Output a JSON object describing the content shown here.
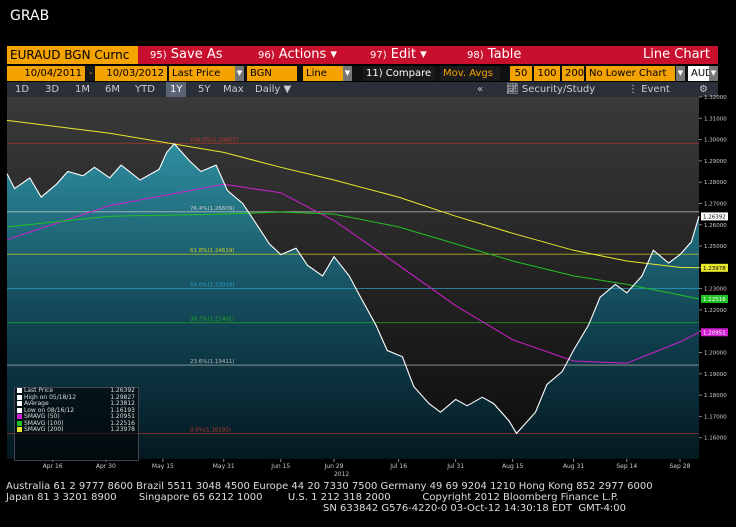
{
  "window_title": "GRAB",
  "toolbar": {
    "ticker": "EURAUD BGN Curnc",
    "actions": [
      {
        "num": "95)",
        "label": "Save As"
      },
      {
        "num": "96)",
        "label": "Actions"
      },
      {
        "num": "97)",
        "label": "Edit"
      },
      {
        "num": "98)",
        "label": "Table"
      }
    ],
    "chart_type": "Line Chart"
  },
  "params": {
    "start_date": "10/04/2011",
    "end_date": "10/03/2012",
    "field": "Last Price",
    "source": "BGN",
    "style": "Line",
    "compare": "11) Compare",
    "mov_avgs": "Mov. Avgs",
    "ma1": "50",
    "ma2": "100",
    "ma3": "200",
    "lower_chart": "No Lower Chart",
    "currency": "AUD"
  },
  "periods": [
    "1D",
    "3D",
    "1M",
    "6M",
    "YTD",
    "1Y",
    "5Y",
    "Max"
  ],
  "active_period": "1Y",
  "frequency": "Daily",
  "links": {
    "security_study": "Security/Study",
    "event": "Event",
    "collapse": "«"
  },
  "legend": [
    {
      "label": "Last Price",
      "value": "1.26392",
      "color": "#ffffff"
    },
    {
      "label": "High on 05/18/12",
      "value": "1.29827",
      "color": "#ffffff"
    },
    {
      "label": "Average",
      "value": "1.23812",
      "color": "#ffffff"
    },
    {
      "label": "Low on 08/16/12",
      "value": "1.16193",
      "color": "#ffffff"
    },
    {
      "label": "SMAVG (50)",
      "value": "1.20951",
      "color": "#d020d0"
    },
    {
      "label": "SMAVG (100)",
      "value": "1.22516",
      "color": "#22c022"
    },
    {
      "label": "SMAVG (200)",
      "value": "1.23978",
      "color": "#e8e830"
    }
  ],
  "footer": {
    "line1": "Australia 61 2 9777 8600 Brazil 5511 3048 4500 Europe 44 20 7330 7500 Germany 49 69 9204 1210 Hong Kong 852 2977 6000",
    "line2": "Japan 81 3 3201 8900       Singapore 65 6212 1000        U.S. 1 212 318 2000          Copyright 2012 Bloomberg Finance L.P.",
    "line3": "SN 633842 G576-4220-0 03-Oct-12 14:30:18 EDT  GMT-4:00"
  },
  "chart_data": {
    "type": "line",
    "title": "",
    "xlabel": "",
    "ylabel": "",
    "x_ticks": [
      "Apr 16",
      "Apr 30",
      "May 15",
      "May 31",
      "Jun 15",
      "Jun 29",
      "Jul 16",
      "Jul 31",
      "Aug 15",
      "Aug 31",
      "Sep 14",
      "Sep 28"
    ],
    "x_year_label": "2012",
    "ylim": [
      1.15,
      1.32
    ],
    "y_ticks": [
      1.16,
      1.17,
      1.18,
      1.19,
      1.2,
      1.21,
      1.22,
      1.23,
      1.24,
      1.25,
      1.26,
      1.27,
      1.28,
      1.29,
      1.3,
      1.31,
      1.32
    ],
    "y_tick_labels": [
      "1.16000",
      "1.17000",
      "1.18000",
      "1.19000",
      "1.20000",
      "1.21000",
      "1.22000",
      "1.23000",
      "1.24000",
      "1.25000",
      "1.26000",
      "1.27000",
      "1.28000",
      "1.29000",
      "1.30000",
      "1.31000",
      "1.32000"
    ],
    "fib_levels": [
      {
        "label": "100.0%(1.29827)",
        "value": 1.29827
      },
      {
        "label": "76.4%(1.26609)",
        "value": 1.26609
      },
      {
        "label": "61.8%(1.24619)",
        "value": 1.24619
      },
      {
        "label": "50.0%(1.23010)",
        "value": 1.2301
      },
      {
        "label": "38.2%(1.21401)",
        "value": 1.21401
      },
      {
        "label": "23.6%(1.19411)",
        "value": 1.19411
      },
      {
        "label": "0.0%(1.16193)",
        "value": 1.16193
      }
    ],
    "last_value_tags": [
      {
        "label": "1.26392",
        "value": 1.26392,
        "color": "#ffffff"
      },
      {
        "label": "1.23978",
        "value": 1.23978,
        "color": "#e8e830"
      },
      {
        "label": "1.22516",
        "value": 1.22516,
        "color": "#22c022"
      },
      {
        "label": "1.20951",
        "value": 1.20951,
        "color": "#d020d0"
      }
    ],
    "x_start": "2012-04-04",
    "x_end": "2012-10-03",
    "series": [
      {
        "name": "Last Price",
        "color": "#ffffff",
        "fill": true,
        "x": [
          "2012-04-04",
          "2012-04-06",
          "2012-04-10",
          "2012-04-13",
          "2012-04-17",
          "2012-04-20",
          "2012-04-24",
          "2012-04-27",
          "2012-05-01",
          "2012-05-04",
          "2012-05-09",
          "2012-05-14",
          "2012-05-16",
          "2012-05-18",
          "2012-05-22",
          "2012-05-25",
          "2012-05-29",
          "2012-06-01",
          "2012-06-05",
          "2012-06-08",
          "2012-06-12",
          "2012-06-15",
          "2012-06-19",
          "2012-06-22",
          "2012-06-26",
          "2012-06-29",
          "2012-07-03",
          "2012-07-06",
          "2012-07-10",
          "2012-07-13",
          "2012-07-17",
          "2012-07-20",
          "2012-07-24",
          "2012-07-27",
          "2012-07-31",
          "2012-08-03",
          "2012-08-07",
          "2012-08-10",
          "2012-08-14",
          "2012-08-16",
          "2012-08-21",
          "2012-08-24",
          "2012-08-28",
          "2012-08-31",
          "2012-09-04",
          "2012-09-07",
          "2012-09-11",
          "2012-09-14",
          "2012-09-18",
          "2012-09-21",
          "2012-09-25",
          "2012-09-28",
          "2012-10-01",
          "2012-10-03"
        ],
        "y": [
          1.284,
          1.277,
          1.282,
          1.273,
          1.279,
          1.285,
          1.283,
          1.287,
          1.282,
          1.288,
          1.281,
          1.286,
          1.294,
          1.298,
          1.29,
          1.285,
          1.288,
          1.276,
          1.27,
          1.262,
          1.251,
          1.246,
          1.249,
          1.241,
          1.236,
          1.245,
          1.236,
          1.226,
          1.213,
          1.201,
          1.198,
          1.184,
          1.176,
          1.172,
          1.178,
          1.175,
          1.179,
          1.176,
          1.168,
          1.162,
          1.172,
          1.185,
          1.191,
          1.201,
          1.213,
          1.226,
          1.232,
          1.228,
          1.236,
          1.248,
          1.242,
          1.246,
          1.252,
          1.264
        ]
      },
      {
        "name": "SMAVG (50)",
        "color": "#d020d0",
        "x": [
          "2012-04-04",
          "2012-05-01",
          "2012-05-31",
          "2012-06-15",
          "2012-06-29",
          "2012-07-16",
          "2012-07-31",
          "2012-08-15",
          "2012-08-31",
          "2012-09-14",
          "2012-09-28",
          "2012-10-03"
        ],
        "y": [
          1.253,
          1.269,
          1.279,
          1.275,
          1.262,
          1.241,
          1.222,
          1.206,
          1.196,
          1.195,
          1.205,
          1.2095
        ]
      },
      {
        "name": "SMAVG (100)",
        "color": "#22c022",
        "x": [
          "2012-04-04",
          "2012-05-01",
          "2012-05-31",
          "2012-06-15",
          "2012-06-29",
          "2012-07-16",
          "2012-07-31",
          "2012-08-15",
          "2012-08-31",
          "2012-09-14",
          "2012-09-28",
          "2012-10-03"
        ],
        "y": [
          1.259,
          1.264,
          1.265,
          1.266,
          1.265,
          1.259,
          1.251,
          1.243,
          1.236,
          1.232,
          1.227,
          1.2252
        ]
      },
      {
        "name": "SMAVG (200)",
        "color": "#e8e830",
        "x": [
          "2012-04-04",
          "2012-05-01",
          "2012-05-31",
          "2012-06-15",
          "2012-06-29",
          "2012-07-16",
          "2012-07-31",
          "2012-08-15",
          "2012-08-31",
          "2012-09-14",
          "2012-09-28",
          "2012-10-03"
        ],
        "y": [
          1.309,
          1.303,
          1.294,
          1.287,
          1.281,
          1.273,
          1.264,
          1.256,
          1.248,
          1.243,
          1.24,
          1.2398
        ]
      }
    ]
  }
}
